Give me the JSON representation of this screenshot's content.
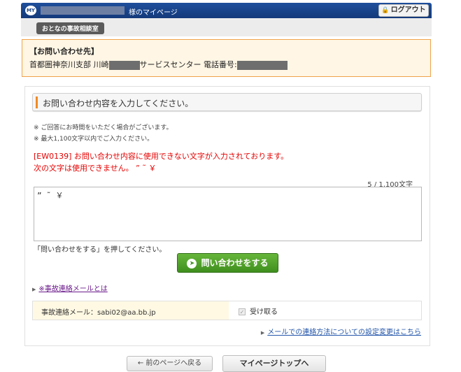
{
  "header": {
    "badge": "MY",
    "mypage_suffix": "様のマイページ",
    "logout_icon": "lock-icon",
    "logout_label": "ログアウト"
  },
  "subnav": {
    "pill": "おとなの事故相談室"
  },
  "contact": {
    "title": "【お問い合わせ先】",
    "prefix": "首都圏神奈川支部 川崎",
    "middle": "サービスセンター 電話番号:"
  },
  "form": {
    "section_title": "お問い合わせ内容を入力してください。",
    "note1": "※ ご回答にお時間をいただく場合がございます。",
    "note2": "※ 最大1,100文字以内でご入力ください。",
    "error1": "[EW0139] お問い合わせ内容に使用できない文字が入力されております。",
    "error2": "次の文字は使用できません。 ”  ˜  ￥",
    "counter": "5 / 1,100文字",
    "textarea_value": "” ˜ ￥",
    "prompt": "「問い合わせをする」を押してください。",
    "submit_icon": "arrow-right-circle-icon",
    "submit_label": "問い合わせをする",
    "accident_mail_link": "※事故連絡メールとは",
    "email_label": "事故連絡メール：sabi02@aa.bb.jp",
    "receive_label": "受け取る",
    "settings_link": "メールでの連絡方法についての設定変更はこちら"
  },
  "footer": {
    "back_label": "← 前のページへ戻る",
    "top_label": "マイページトップへ"
  }
}
